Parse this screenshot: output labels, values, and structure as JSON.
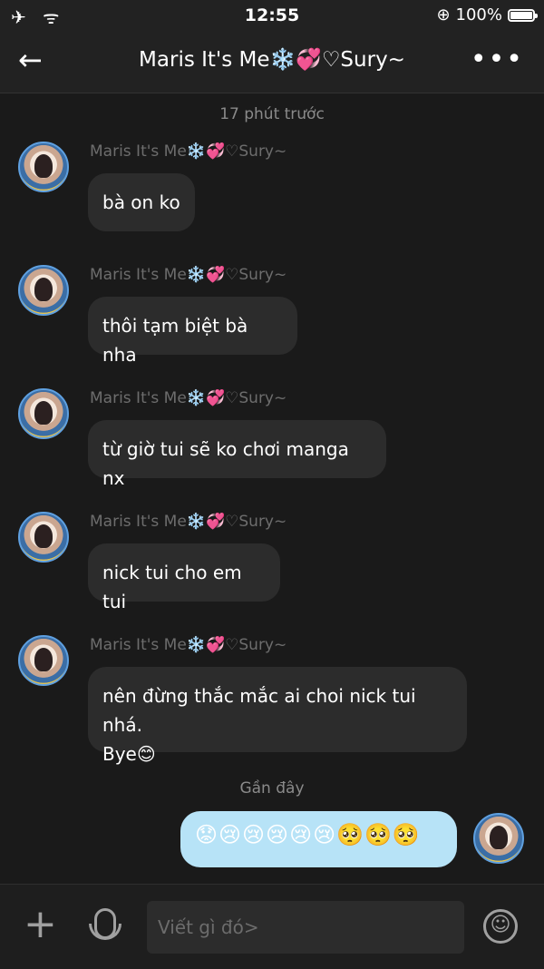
{
  "status_bar": {
    "left_icons": "✈ ᯤ",
    "time": "12:55",
    "battery_text": "100%",
    "battery_level": 1.0
  },
  "header": {
    "back_icon": "←",
    "title": "Maris It's Me❄️💞♡Sury~",
    "more_icon": "•••"
  },
  "timestamps": [
    "17 phút trước",
    "Gần đây"
  ],
  "messages": [
    {
      "sender": "Maris It's Me❄️💞♡Sury~",
      "lines": [
        "bà on ko"
      ]
    },
    {
      "sender": "Maris It's Me❄️💞♡Sury~",
      "lines": [
        "thôi tạm biệt bà nha"
      ]
    },
    {
      "sender": "Maris It's Me❄️💞♡Sury~",
      "lines": [
        "từ giờ tui sẽ ko chơi manga nx"
      ]
    },
    {
      "sender": "Maris It's Me❄️💞♡Sury~",
      "lines": [
        "nick tui cho em tui"
      ]
    },
    {
      "sender": "Maris It's Me❄️💞♡Sury~",
      "lines": [
        "nên đừng thắc mắc ai choi nick tui nhá.",
        "Bye😊"
      ]
    }
  ],
  "my_message": {
    "text": "😟😢😢😢😢😢🥺🥺🥺"
  },
  "input_bar": {
    "plus_icon": "+",
    "placeholder": "Viết gì đó>",
    "emoji_icon": "☺"
  }
}
